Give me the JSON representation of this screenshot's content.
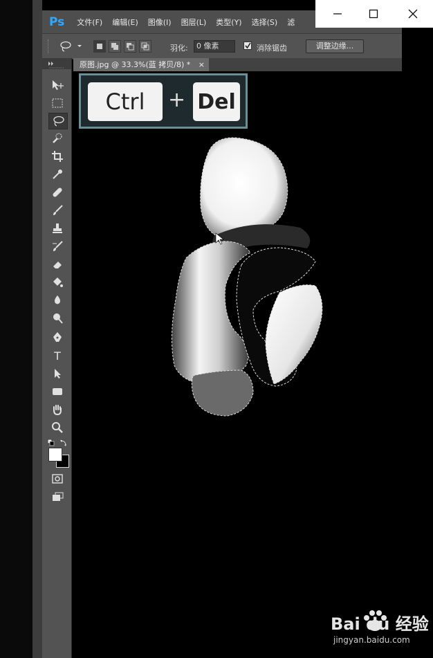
{
  "app": {
    "logo": "Ps"
  },
  "menu": [
    "文件(F)",
    "编辑(E)",
    "图像(I)",
    "图层(L)",
    "类型(Y)",
    "选择(S)",
    "滤"
  ],
  "options_bar": {
    "feather_label": "羽化:",
    "feather_value": "0 像素",
    "antialias_label": "消除锯齿",
    "antialias_checked": true,
    "refine_button": "调整边缘..."
  },
  "document": {
    "tab_title": "原图.jpg @ 33.3%(蓝 拷贝/8) *",
    "close": "×"
  },
  "overlay": {
    "key1": "Ctrl",
    "plus": "+",
    "key2": "Del"
  },
  "watermark": {
    "brand": "Bai du 经验",
    "url": "jingyan.baidu.com"
  },
  "colors": {
    "accent": "#31a8ff",
    "panel": "#535353",
    "menubar": "#4e4e4e",
    "overlay_border": "#6c8f97"
  }
}
